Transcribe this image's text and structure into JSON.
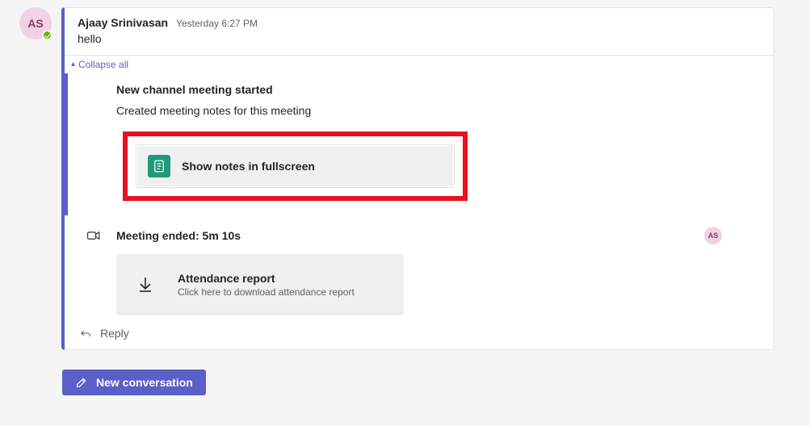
{
  "colors": {
    "accent": "#5b5fc7",
    "highlight": "#e81123",
    "notesIcon": "#1f9b7c"
  },
  "thread": {
    "sender": {
      "name": "Ajaay Srinivasan",
      "initials": "AS",
      "presence": "available"
    },
    "timestamp": "Yesterday 6:27 PM",
    "message": "hello",
    "collapse_label": "Collapse all",
    "meeting": {
      "started_label": "New channel meeting started",
      "notes_created_label": "Created meeting notes for this meeting",
      "show_notes_label": "Show notes in fullscreen"
    },
    "ended": {
      "label": "Meeting ended: 5m 10s",
      "participant_initials": "AS"
    },
    "attendance": {
      "title": "Attendance report",
      "description": "Click here to download attendance report"
    },
    "reply_label": "Reply"
  },
  "composer": {
    "new_conversation_label": "New conversation"
  }
}
